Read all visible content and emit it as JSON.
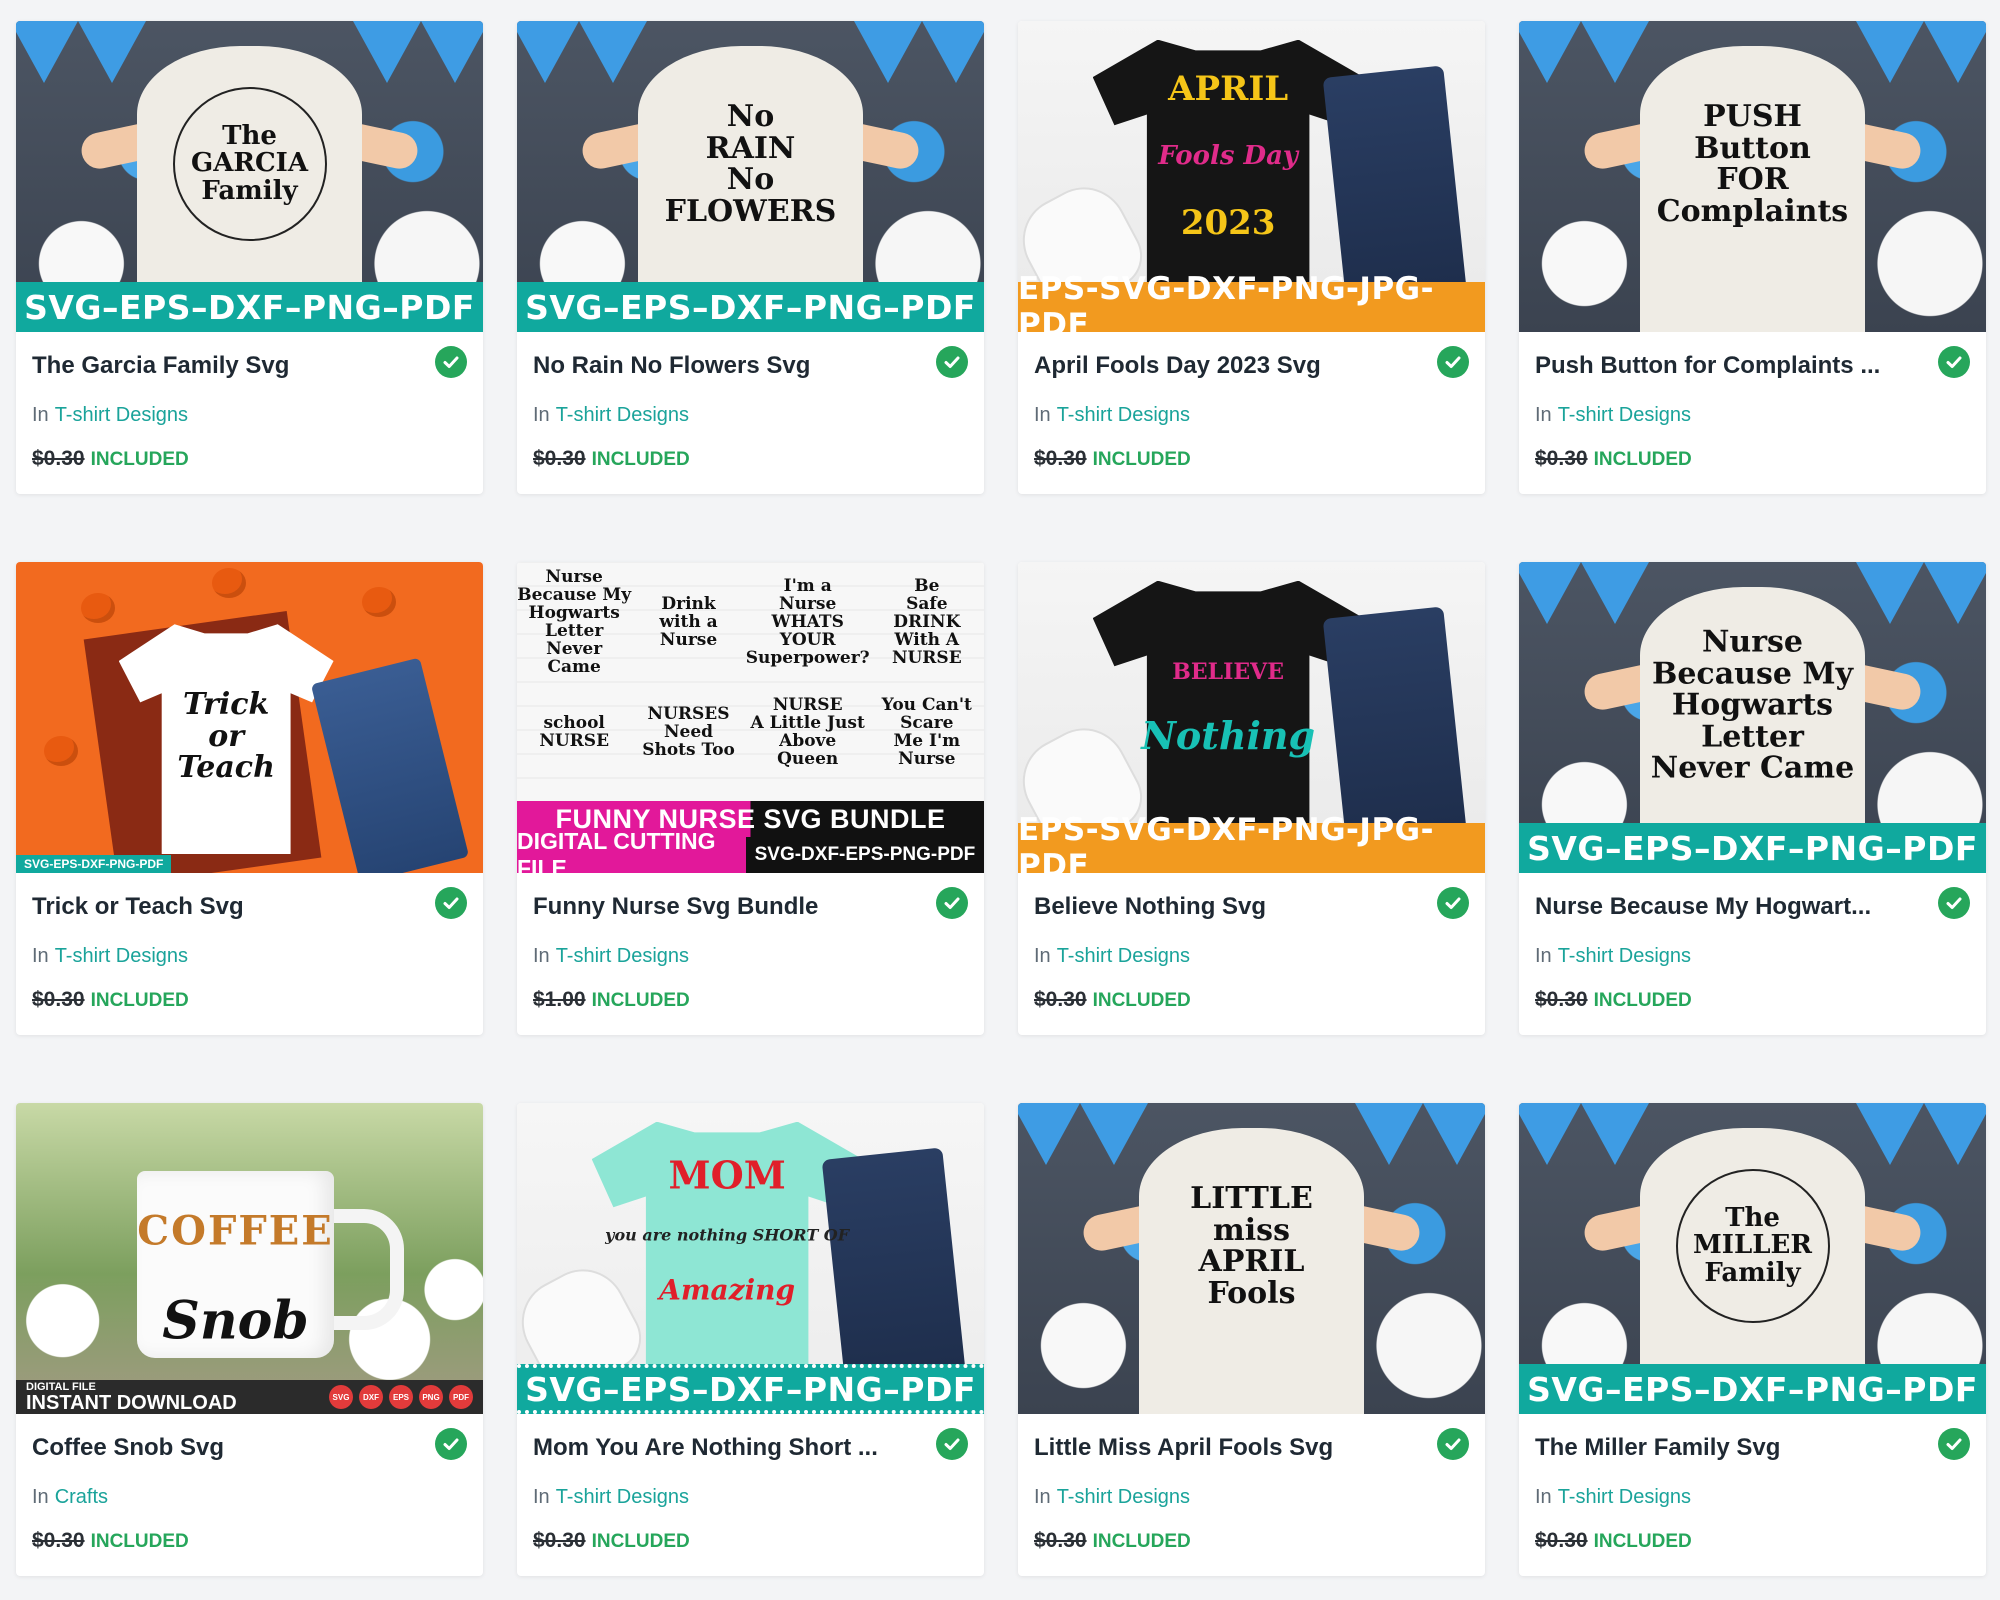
{
  "colors": {
    "accent_teal": "#10a99e",
    "accent_orange": "#f29a1f",
    "included_green": "#26a65b",
    "category_link": "#1aa39a"
  },
  "products": [
    {
      "title": "The Garcia Family Svg",
      "category_prefix": "In",
      "category": "T-shirt Designs",
      "old_price": "$0.30",
      "status": "INCLUDED",
      "image": {
        "style": "kid",
        "design": "The\nGARCIA\nFamily",
        "format": "SVG–EPS–DXF–PNG–PDF"
      }
    },
    {
      "title": "No Rain No Flowers Svg",
      "category_prefix": "In",
      "category": "T-shirt Designs",
      "old_price": "$0.30",
      "status": "INCLUDED",
      "image": {
        "style": "kid",
        "design": "No\nRAIN\nNo\nFLOWERS",
        "format": "SVG–EPS–DXF–PNG–PDF"
      }
    },
    {
      "title": "April Fools Day 2023 Svg",
      "category_prefix": "In",
      "category": "T-shirt Designs",
      "old_price": "$0.30",
      "status": "INCLUDED",
      "image": {
        "style": "tee-black",
        "design_lines": [
          "APRIL",
          "Fools Day",
          "2023"
        ],
        "format": "EPS-SVG-DXF-PNG-JPG-PDF"
      }
    },
    {
      "title": "Push Button for Complaints ...",
      "category_prefix": "In",
      "category": "T-shirt Designs",
      "old_price": "$0.30",
      "status": "INCLUDED",
      "image": {
        "style": "kid",
        "design": "PUSH\nButton\nFOR\nComplaints"
      }
    },
    {
      "title": "Trick or Teach Svg",
      "category_prefix": "In",
      "category": "T-shirt Designs",
      "old_price": "$0.30",
      "status": "INCLUDED",
      "image": {
        "style": "orange",
        "design": "Trick\nor\nTeach",
        "tag": "SVG-EPS-DXF-PNG-PDF"
      }
    },
    {
      "title": "Funny Nurse Svg Bundle",
      "category_prefix": "In",
      "category": "T-shirt Designs",
      "old_price": "$1.00",
      "status": "INCLUDED",
      "image": {
        "style": "collage",
        "cells": [
          "Nurse\nBecause My\nHogwarts\nLetter\nNever Came",
          "Drink\nwith a\nNurse",
          "I'm a\nNurse\nWHATS YOUR\nSuperpower?",
          "Be\nSafe\nDRINK\nWith A\nNURSE",
          "school\nNURSE",
          "NURSES\nNeed\nShots Too",
          "NURSE\nA Little Just Above Queen",
          "You Can't\nScare\nMe I'm\nNurse"
        ],
        "banner": "FUNNY NURSE SVG BUNDLE",
        "banner_left": "DIGITAL CUTTING FILE",
        "banner_right": "SVG-DXF-EPS-PNG-PDF"
      }
    },
    {
      "title": "Believe Nothing Svg",
      "category_prefix": "In",
      "category": "T-shirt Designs",
      "old_price": "$0.30",
      "status": "INCLUDED",
      "image": {
        "style": "tee-black",
        "design_lines": [
          "BELIEVE",
          "Nothing"
        ],
        "format": "EPS-SVG-DXF-PNG-JPG-PDF"
      }
    },
    {
      "title": "Nurse Because My Hogwart...",
      "category_prefix": "In",
      "category": "T-shirt Designs",
      "old_price": "$0.30",
      "status": "INCLUDED",
      "image": {
        "style": "kid",
        "design": "Nurse\nBecause My\nHogwarts\nLetter\nNever Came",
        "format": "SVG–EPS–DXF–PNG–PDF"
      }
    },
    {
      "title": "Coffee Snob Svg",
      "category_prefix": "In",
      "category": "Crafts",
      "old_price": "$0.30",
      "status": "INCLUDED",
      "image": {
        "style": "mug",
        "design_lines": [
          "COFFEE",
          "Snob"
        ],
        "bar_small": "DIGITAL FILE",
        "bar_label": "INSTANT DOWNLOAD",
        "badges": [
          "SVG",
          "DXF",
          "EPS",
          "PNG",
          "PDF"
        ]
      }
    },
    {
      "title": "Mom You Are Nothing Short ...",
      "category_prefix": "In",
      "category": "T-shirt Designs",
      "old_price": "$0.30",
      "status": "INCLUDED",
      "image": {
        "style": "tee-mint",
        "design_lines": [
          "MOM",
          "you are nothing SHORT OF",
          "Amazing"
        ],
        "format": "SVG–EPS–DXF–PNG–PDF"
      }
    },
    {
      "title": "Little Miss April Fools Svg",
      "category_prefix": "In",
      "category": "T-shirt Designs",
      "old_price": "$0.30",
      "status": "INCLUDED",
      "image": {
        "style": "kid",
        "design": "LITTLE\nmiss\nAPRIL\nFools"
      }
    },
    {
      "title": "The Miller Family Svg",
      "category_prefix": "In",
      "category": "T-shirt Designs",
      "old_price": "$0.30",
      "status": "INCLUDED",
      "image": {
        "style": "kid",
        "design": "The\nMILLER\nFamily",
        "format": "SVG–EPS–DXF–PNG–PDF"
      }
    }
  ]
}
